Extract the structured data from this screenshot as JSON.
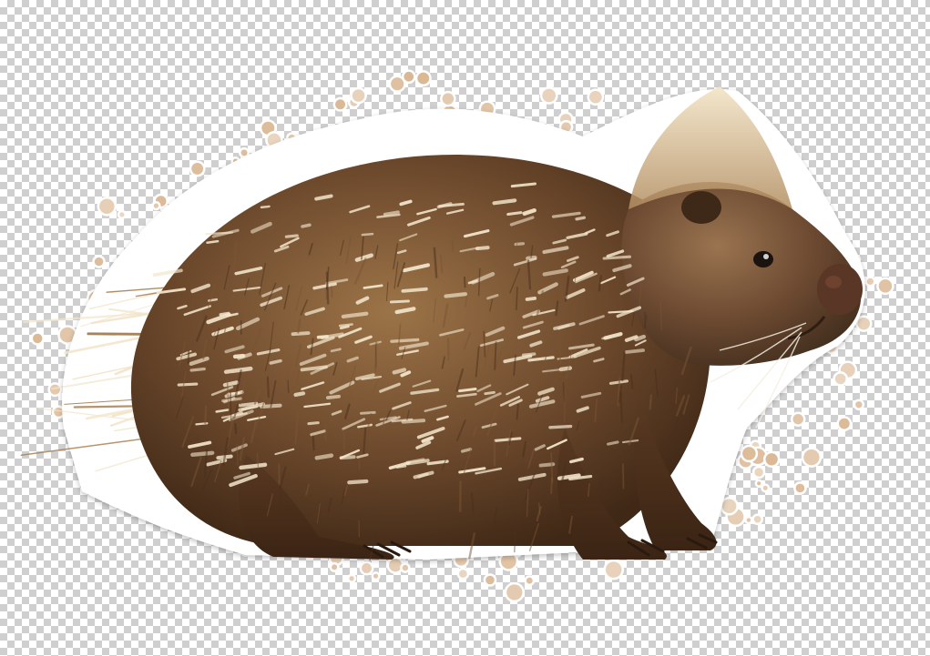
{
  "image": {
    "subject": "porcupine",
    "style": "sticker",
    "background": "transparency-checkerboard",
    "colors": {
      "checker_light": "#ffffff",
      "checker_dark": "#cfcfcf",
      "fur_dark": "#4a2f1c",
      "fur_mid": "#7a5535",
      "fur_light": "#a98359",
      "quill_cream": "#f3e6cc",
      "nose": "#5a3626",
      "eye": "#1a1310",
      "splatter_tan": "#d9b48e",
      "sticker_border": "#ffffff"
    }
  }
}
